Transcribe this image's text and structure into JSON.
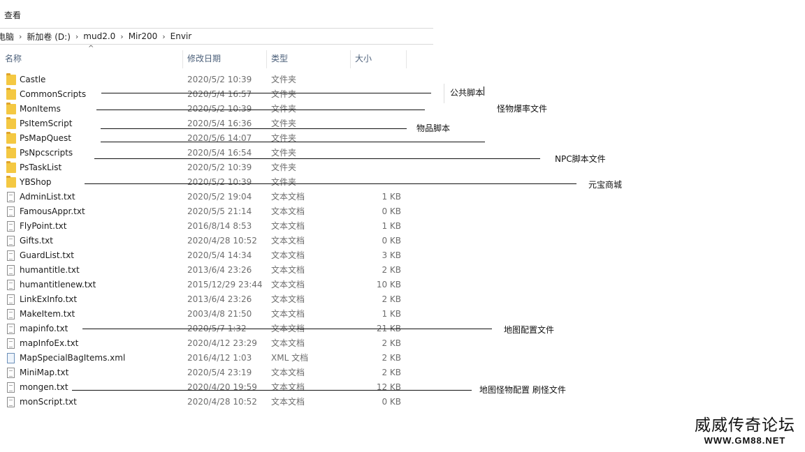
{
  "menu": {
    "view": "查看"
  },
  "breadcrumb": [
    "电脑",
    "新加卷 (D:)",
    "mud2.0",
    "Mir200",
    "Envir"
  ],
  "columns": {
    "name": "名称",
    "date": "修改日期",
    "type": "类型",
    "size": "大小"
  },
  "files": [
    {
      "name": "Castle",
      "date": "2020/5/2 10:39",
      "type": "文件夹",
      "size": "",
      "icon": "folder-icon"
    },
    {
      "name": "CommonScripts",
      "date": "2020/5/4 16:57",
      "type": "文件夹",
      "size": "",
      "icon": "folder-icon"
    },
    {
      "name": "MonItems",
      "date": "2020/5/2 10:39",
      "type": "文件夹",
      "size": "",
      "icon": "folder-icon"
    },
    {
      "name": "PsItemScript",
      "date": "2020/5/4 16:36",
      "type": "文件夹",
      "size": "",
      "icon": "folder-icon"
    },
    {
      "name": "PsMapQuest",
      "date": "2020/5/6 14:07",
      "type": "文件夹",
      "size": "",
      "icon": "folder-icon"
    },
    {
      "name": "PsNpcscripts",
      "date": "2020/5/4 16:54",
      "type": "文件夹",
      "size": "",
      "icon": "folder-icon"
    },
    {
      "name": "PsTaskList",
      "date": "2020/5/2 10:39",
      "type": "文件夹",
      "size": "",
      "icon": "folder-icon"
    },
    {
      "name": "YBShop",
      "date": "2020/5/2 10:39",
      "type": "文件夹",
      "size": "",
      "icon": "folder-icon"
    },
    {
      "name": "AdminList.txt",
      "date": "2020/5/2 19:04",
      "type": "文本文档",
      "size": "1 KB",
      "icon": "text-file-icon"
    },
    {
      "name": "FamousAppr.txt",
      "date": "2020/5/5 21:14",
      "type": "文本文档",
      "size": "0 KB",
      "icon": "text-file-icon"
    },
    {
      "name": "FlyPoint.txt",
      "date": "2016/8/14 8:53",
      "type": "文本文档",
      "size": "1 KB",
      "icon": "text-file-icon"
    },
    {
      "name": "Gifts.txt",
      "date": "2020/4/28 10:52",
      "type": "文本文档",
      "size": "0 KB",
      "icon": "text-file-icon"
    },
    {
      "name": "GuardList.txt",
      "date": "2020/5/4 14:34",
      "type": "文本文档",
      "size": "3 KB",
      "icon": "text-file-icon"
    },
    {
      "name": "humantitle.txt",
      "date": "2013/6/4 23:26",
      "type": "文本文档",
      "size": "2 KB",
      "icon": "text-file-icon"
    },
    {
      "name": "humantitlenew.txt",
      "date": "2015/12/29 23:44",
      "type": "文本文档",
      "size": "10 KB",
      "icon": "text-file-icon"
    },
    {
      "name": "LinkExInfo.txt",
      "date": "2013/6/4 23:26",
      "type": "文本文档",
      "size": "2 KB",
      "icon": "text-file-icon"
    },
    {
      "name": "MakeItem.txt",
      "date": "2003/4/8 21:50",
      "type": "文本文档",
      "size": "1 KB",
      "icon": "text-file-icon"
    },
    {
      "name": "mapinfo.txt",
      "date": "2020/5/7 1:32",
      "type": "文本文档",
      "size": "21 KB",
      "icon": "text-file-icon"
    },
    {
      "name": "mapInfoEx.txt",
      "date": "2020/4/12 23:29",
      "type": "文本文档",
      "size": "2 KB",
      "icon": "text-file-icon"
    },
    {
      "name": "MapSpecialBagItems.xml",
      "date": "2016/4/12 1:03",
      "type": "XML 文档",
      "size": "2 KB",
      "icon": "xml-file-icon"
    },
    {
      "name": "MiniMap.txt",
      "date": "2020/5/4 23:19",
      "type": "文本文档",
      "size": "2 KB",
      "icon": "text-file-icon"
    },
    {
      "name": "mongen.txt",
      "date": "2020/4/20 19:59",
      "type": "文本文档",
      "size": "12 KB",
      "icon": "text-file-icon"
    },
    {
      "name": "monScript.txt",
      "date": "2020/4/28 10:52",
      "type": "文本文档",
      "size": "0 KB",
      "icon": "text-file-icon"
    }
  ],
  "annotations": [
    {
      "text": "公共脚本"
    },
    {
      "text": "怪物爆率文件"
    },
    {
      "text": "物品脚本"
    },
    {
      "text": "NPC脚本文件"
    },
    {
      "text": "元宝商城"
    },
    {
      "text": "地图配置文件"
    },
    {
      "text": "地图怪物配置  刷怪文件"
    }
  ],
  "watermark": {
    "title": "威威传奇论坛",
    "url": "WWW.GM88.NET"
  }
}
